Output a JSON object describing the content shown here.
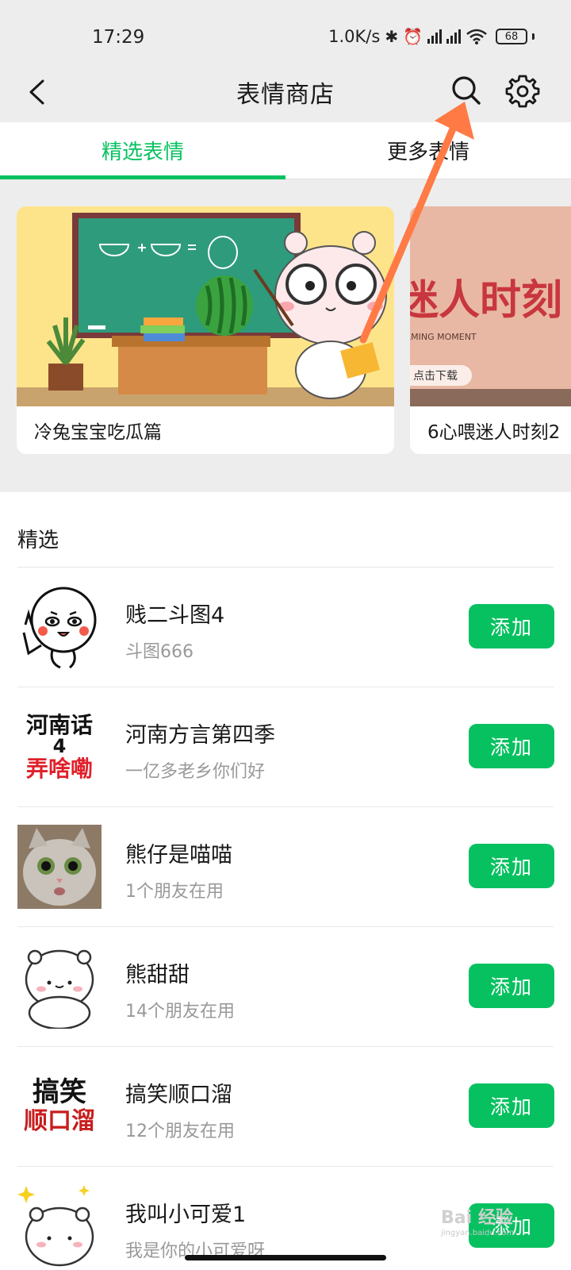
{
  "status_bar": {
    "time": "17:29",
    "net_speed": "1.0K/s",
    "battery": "68"
  },
  "nav": {
    "title": "表情商店"
  },
  "tabs": [
    {
      "label": "精选表情",
      "active": true
    },
    {
      "label": "更多表情",
      "active": false
    }
  ],
  "banners": [
    {
      "title": "冷兔宝宝吃瓜篇"
    },
    {
      "title": "6心喂迷人时刻2",
      "art_text": "迷人时刻",
      "art_sub": "CHARMING MOMENT",
      "art_button": "点击下载"
    }
  ],
  "section": {
    "title": "精选"
  },
  "thumb_text": {
    "henan_line1": "河南话",
    "henan_line2": "4",
    "henan_line3": "弄啥嘞",
    "gaoxiao_line1": "搞笑",
    "gaoxiao_line2": "顺口溜"
  },
  "items": [
    {
      "name": "贱二斗图4",
      "subtitle": "斗图666",
      "button": "添加",
      "icon": "cartoon-face-icon"
    },
    {
      "name": "河南方言第四季",
      "subtitle": "一亿多老乡你们好",
      "button": "添加",
      "icon": "henan-text-thumb"
    },
    {
      "name": "熊仔是喵喵",
      "subtitle": "1个朋友在用",
      "button": "添加",
      "icon": "cat-photo-thumb"
    },
    {
      "name": "熊甜甜",
      "subtitle": "14个朋友在用",
      "button": "添加",
      "icon": "bear-thumb"
    },
    {
      "name": "搞笑顺口溜",
      "subtitle": "12个朋友在用",
      "button": "添加",
      "icon": "gaoxiao-text-thumb"
    },
    {
      "name": "我叫小可爱1",
      "subtitle": "我是你的小可爱呀",
      "button": "添加",
      "icon": "cute-bear-thumb"
    }
  ],
  "colors": {
    "accent": "#07c160",
    "background": "#ededed",
    "annotation_arrow": "#ff7a45"
  },
  "watermark": {
    "text": "Bai 经验",
    "sub": "jingyan.baidu.com"
  }
}
